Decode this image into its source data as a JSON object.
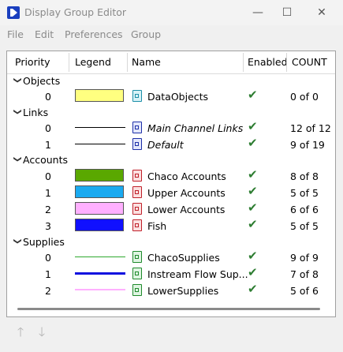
{
  "window": {
    "title": "Display Group Editor",
    "minimize": "—",
    "maximize": "☐",
    "close": "✕"
  },
  "menu": [
    "File",
    "Edit",
    "Preferences",
    "Group"
  ],
  "columns": {
    "priority": "Priority",
    "legend": "Legend",
    "name": "Name",
    "enabled": "Enabled",
    "count": "COUNT"
  },
  "groups": [
    {
      "label": "Objects",
      "rows": [
        {
          "priority": "0",
          "legend": {
            "kind": "swatch",
            "color": "#ffff80"
          },
          "icon": "teal-document-icon",
          "name": "DataObjects",
          "italic": false,
          "enabled": "✔",
          "count": "0 of 0"
        }
      ]
    },
    {
      "label": "Links",
      "rows": [
        {
          "priority": "0",
          "legend": {
            "kind": "line",
            "color": "#000000",
            "thickness": "thin"
          },
          "icon": "blue-document-icon",
          "name": "Main Channel Links",
          "italic": true,
          "enabled": "✔",
          "count": "12 of 12"
        },
        {
          "priority": "1",
          "legend": {
            "kind": "line",
            "color": "#000000",
            "thickness": "thin"
          },
          "icon": "blue-document-icon",
          "name": "Default",
          "italic": true,
          "enabled": "✔",
          "count": "9 of 19"
        }
      ]
    },
    {
      "label": "Accounts",
      "rows": [
        {
          "priority": "0",
          "legend": {
            "kind": "swatch",
            "color": "#5aa800"
          },
          "icon": "red-document-icon",
          "name": "Chaco Accounts",
          "italic": false,
          "enabled": "✔",
          "count": "8 of 8"
        },
        {
          "priority": "1",
          "legend": {
            "kind": "swatch",
            "color": "#1aaaf0"
          },
          "icon": "red-document-icon",
          "name": "Upper Accounts",
          "italic": false,
          "enabled": "✔",
          "count": "5 of 5"
        },
        {
          "priority": "2",
          "legend": {
            "kind": "swatch",
            "color": "#ffb0ff"
          },
          "icon": "red-document-icon",
          "name": "Lower Accounts",
          "italic": false,
          "enabled": "✔",
          "count": "6 of 6"
        },
        {
          "priority": "3",
          "legend": {
            "kind": "swatch",
            "color": "#1010ff"
          },
          "icon": "red-document-icon",
          "name": "Fish",
          "italic": false,
          "enabled": "✔",
          "count": "5 of 5"
        }
      ]
    },
    {
      "label": "Supplies",
      "rows": [
        {
          "priority": "0",
          "legend": {
            "kind": "line",
            "color": "#2fa82f",
            "thickness": "thin"
          },
          "icon": "green-document-icon",
          "name": "ChacoSupplies",
          "italic": false,
          "enabled": "✔",
          "count": "9 of 9"
        },
        {
          "priority": "1",
          "legend": {
            "kind": "line",
            "color": "#1010e0",
            "thickness": "thick"
          },
          "icon": "green-document-icon",
          "name": "Instream Flow Sup...",
          "italic": false,
          "enabled": "✔",
          "count": "7 of 8"
        },
        {
          "priority": "2",
          "legend": {
            "kind": "line",
            "color": "#ffb0ff",
            "thickness": "medium"
          },
          "icon": "green-document-icon",
          "name": "LowerSupplies",
          "italic": false,
          "enabled": "✔",
          "count": "5 of 6"
        }
      ]
    }
  ],
  "footer": {
    "up_arrow": "🡑",
    "down_arrow": "🡓"
  }
}
